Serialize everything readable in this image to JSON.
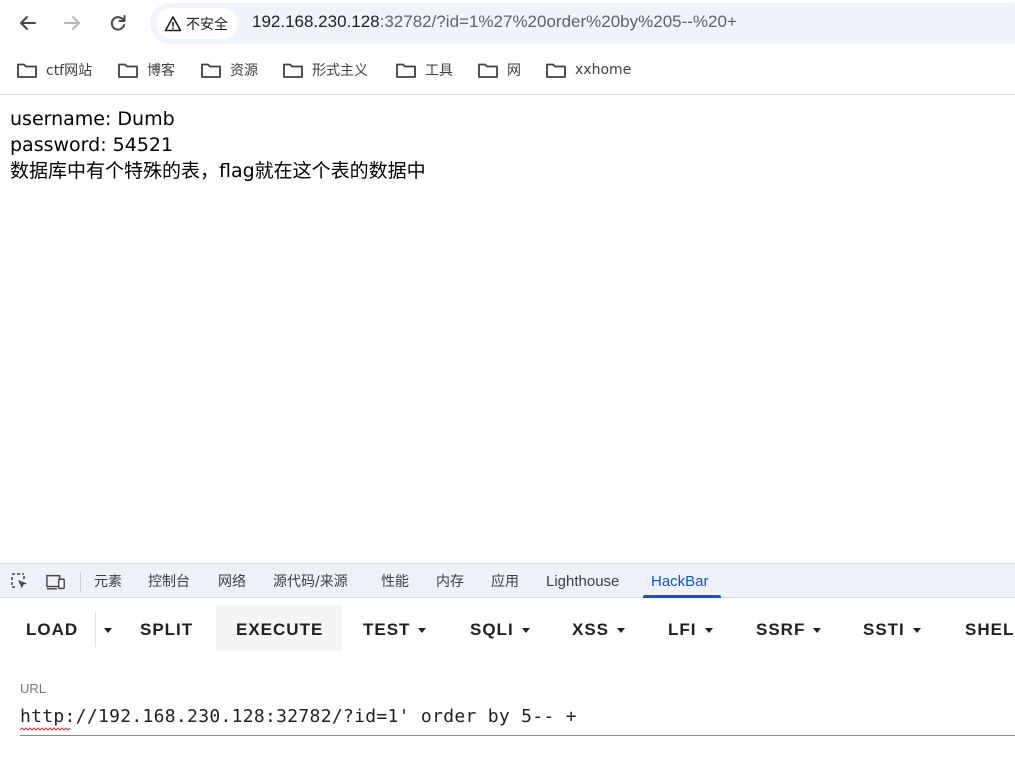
{
  "browser": {
    "security_label": "不安全",
    "url_host": "192.168.230.128",
    "url_rest": ":32782/?id=1%27%20order%20by%205--%20+"
  },
  "bookmarks": [
    {
      "label": "ctf网站",
      "icon": "folder-icon"
    },
    {
      "label": "博客",
      "icon": "folder-icon"
    },
    {
      "label": "资源",
      "icon": "folder-icon"
    },
    {
      "label": "形式主义",
      "icon": "folder-icon"
    },
    {
      "label": "工具",
      "icon": "folder-icon"
    },
    {
      "label": "网",
      "icon": "folder-icon"
    },
    {
      "label": "xxhome",
      "icon": "folder-icon"
    }
  ],
  "page": {
    "line1": "username: Dumb",
    "line2": "password: 54521",
    "line3": "数据库中有个特殊的表，flag就在这个表的数据中"
  },
  "devtools": {
    "tabs": [
      {
        "label": "元素"
      },
      {
        "label": "控制台"
      },
      {
        "label": "网络"
      },
      {
        "label": "源代码/来源"
      },
      {
        "label": "性能"
      },
      {
        "label": "内存"
      },
      {
        "label": "应用"
      },
      {
        "label": "Lighthouse"
      },
      {
        "label": "HackBar",
        "active": true
      }
    ],
    "accent": "#0b57d0"
  },
  "hackbar": {
    "buttons": [
      {
        "label": "LOAD"
      },
      {
        "label": "SPLIT"
      },
      {
        "label": "EXECUTE"
      },
      {
        "label": "TEST"
      },
      {
        "label": "SQLI"
      },
      {
        "label": "XSS"
      },
      {
        "label": "LFI"
      },
      {
        "label": "SSRF"
      },
      {
        "label": "SSTI"
      },
      {
        "label": "SHEL"
      }
    ],
    "url_label": "URL",
    "url_value": "http://192.168.230.128:32782/?id=1' order by 5-- +"
  }
}
